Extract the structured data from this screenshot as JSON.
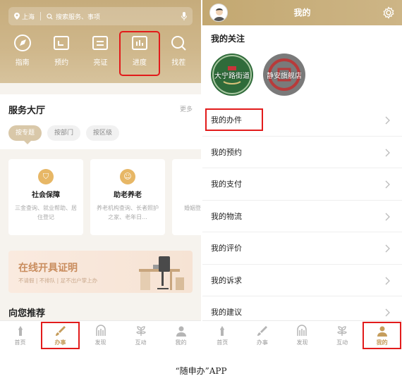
{
  "left": {
    "search": {
      "location": "上海",
      "placeholder": "搜索服务、事项"
    },
    "quick_actions": [
      {
        "label": "指南",
        "icon": "compass-icon"
      },
      {
        "label": "预约",
        "icon": "calendar-icon"
      },
      {
        "label": "亮证",
        "icon": "id-card-icon"
      },
      {
        "label": "进度",
        "icon": "progress-chart-icon",
        "highlighted": true
      },
      {
        "label": "找茬",
        "icon": "magnifier-icon"
      }
    ],
    "service_hall": {
      "title": "服务大厅",
      "more": "更多",
      "chips": [
        "按专题",
        "按部门",
        "按区级"
      ],
      "selected_chip": "按专题"
    },
    "services": [
      {
        "title": "社会保障",
        "desc": "三金查询、就业帮助、居住登记",
        "icon": "shield-icon"
      },
      {
        "title": "助老养老",
        "desc": "养老机构查询、长者照护之家、老年日...",
        "icon": "elder-icon"
      },
      {
        "title": "婚",
        "desc": "婚姻登记、接种疫苗",
        "icon": "marriage-icon"
      }
    ],
    "banner": {
      "title": "在线开具证明",
      "subtitle": "不请假 | 不排队 | 足不出户掌上办"
    },
    "recommend_title": "向您推荐",
    "tabbar": [
      {
        "label": "首页",
        "icon": "home-icon"
      },
      {
        "label": "办事",
        "icon": "brush-icon",
        "active": true,
        "highlighted": true
      },
      {
        "label": "发现",
        "icon": "discover-icon"
      },
      {
        "label": "互动",
        "icon": "interact-icon"
      },
      {
        "label": "我的",
        "icon": "user-icon"
      }
    ]
  },
  "right": {
    "header_title": "我的",
    "follow_title": "我的关注",
    "follows": [
      {
        "name": "大宁路街道",
        "color": "#2f6b3a"
      },
      {
        "name": "静安旗舰店",
        "color": "#7a7a7a"
      }
    ],
    "menu": [
      {
        "label": "我的办件",
        "highlighted": true
      },
      {
        "label": "我的预约"
      },
      {
        "label": "我的支付"
      },
      {
        "label": "我的物流"
      },
      {
        "label": "我的评价"
      },
      {
        "label": "我的诉求"
      },
      {
        "label": "我的建议"
      }
    ],
    "tabbar": [
      {
        "label": "首页",
        "icon": "home-icon"
      },
      {
        "label": "办事",
        "icon": "brush-icon"
      },
      {
        "label": "发现",
        "icon": "discover-icon"
      },
      {
        "label": "互动",
        "icon": "interact-icon"
      },
      {
        "label": "我的",
        "icon": "user-icon",
        "active": true,
        "highlighted": true
      }
    ]
  },
  "caption": "“随申办”APP",
  "colors": {
    "gold": "#c6ac7c",
    "highlight": "#e21b1b",
    "active_tab": "#c59d5c"
  }
}
